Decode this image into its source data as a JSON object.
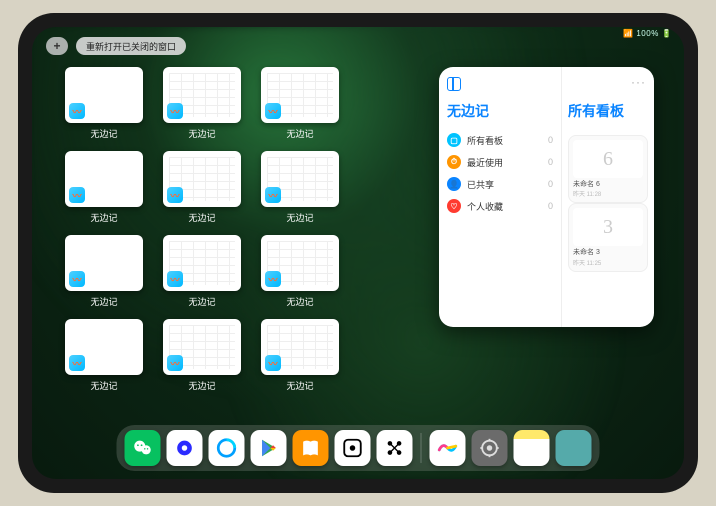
{
  "status": {
    "indicator": "📶 100% 🔋"
  },
  "top": {
    "plus_symbol": "+",
    "reopen_label": "重新打开已关闭的窗口"
  },
  "thumbs": [
    {
      "label": "无边记",
      "variant": "blank"
    },
    {
      "label": "无边记",
      "variant": "grid"
    },
    {
      "label": "无边记",
      "variant": "grid"
    },
    {
      "label": "无边记",
      "variant": "blank"
    },
    {
      "label": "无边记",
      "variant": "grid"
    },
    {
      "label": "无边记",
      "variant": "grid"
    },
    {
      "label": "无边记",
      "variant": "blank"
    },
    {
      "label": "无边记",
      "variant": "grid"
    },
    {
      "label": "无边记",
      "variant": "grid"
    },
    {
      "label": "无边记",
      "variant": "blank"
    },
    {
      "label": "无边记",
      "variant": "grid"
    },
    {
      "label": "无边记",
      "variant": "grid"
    }
  ],
  "panel": {
    "ellipsis": "···",
    "left_title": "无边记",
    "right_title": "所有看板",
    "categories": [
      {
        "label": "所有看板",
        "count": 0,
        "color": "#00c3ff",
        "glyph": "▢"
      },
      {
        "label": "最近使用",
        "count": 0,
        "color": "#ff9500",
        "glyph": "⏱"
      },
      {
        "label": "已共享",
        "count": 0,
        "color": "#0a84ff",
        "glyph": "👤"
      },
      {
        "label": "个人收藏",
        "count": 0,
        "color": "#ff3b30",
        "glyph": "♡"
      }
    ],
    "boards": [
      {
        "sketch": "6",
        "name": "未命名 6",
        "time": "昨天 11:28"
      },
      {
        "sketch": "3",
        "name": "未命名 3",
        "time": "昨天 11:25"
      }
    ]
  },
  "dock": {
    "apps_left": [
      {
        "name": "wechat",
        "cls": "ic-wechat"
      },
      {
        "name": "quark",
        "cls": "ic-quark"
      },
      {
        "name": "qqbrowser",
        "cls": "ic-qqbrowser"
      },
      {
        "name": "play",
        "cls": "ic-play"
      },
      {
        "name": "books",
        "cls": "ic-books"
      },
      {
        "name": "dot-app",
        "cls": "ic-dot"
      },
      {
        "name": "dots-app",
        "cls": "ic-dots"
      }
    ],
    "apps_right": [
      {
        "name": "freeform",
        "cls": "ic-freeform"
      },
      {
        "name": "settings",
        "cls": "ic-settings"
      },
      {
        "name": "notes",
        "cls": "ic-notes"
      },
      {
        "name": "app-library",
        "cls": "ic-library"
      }
    ]
  }
}
